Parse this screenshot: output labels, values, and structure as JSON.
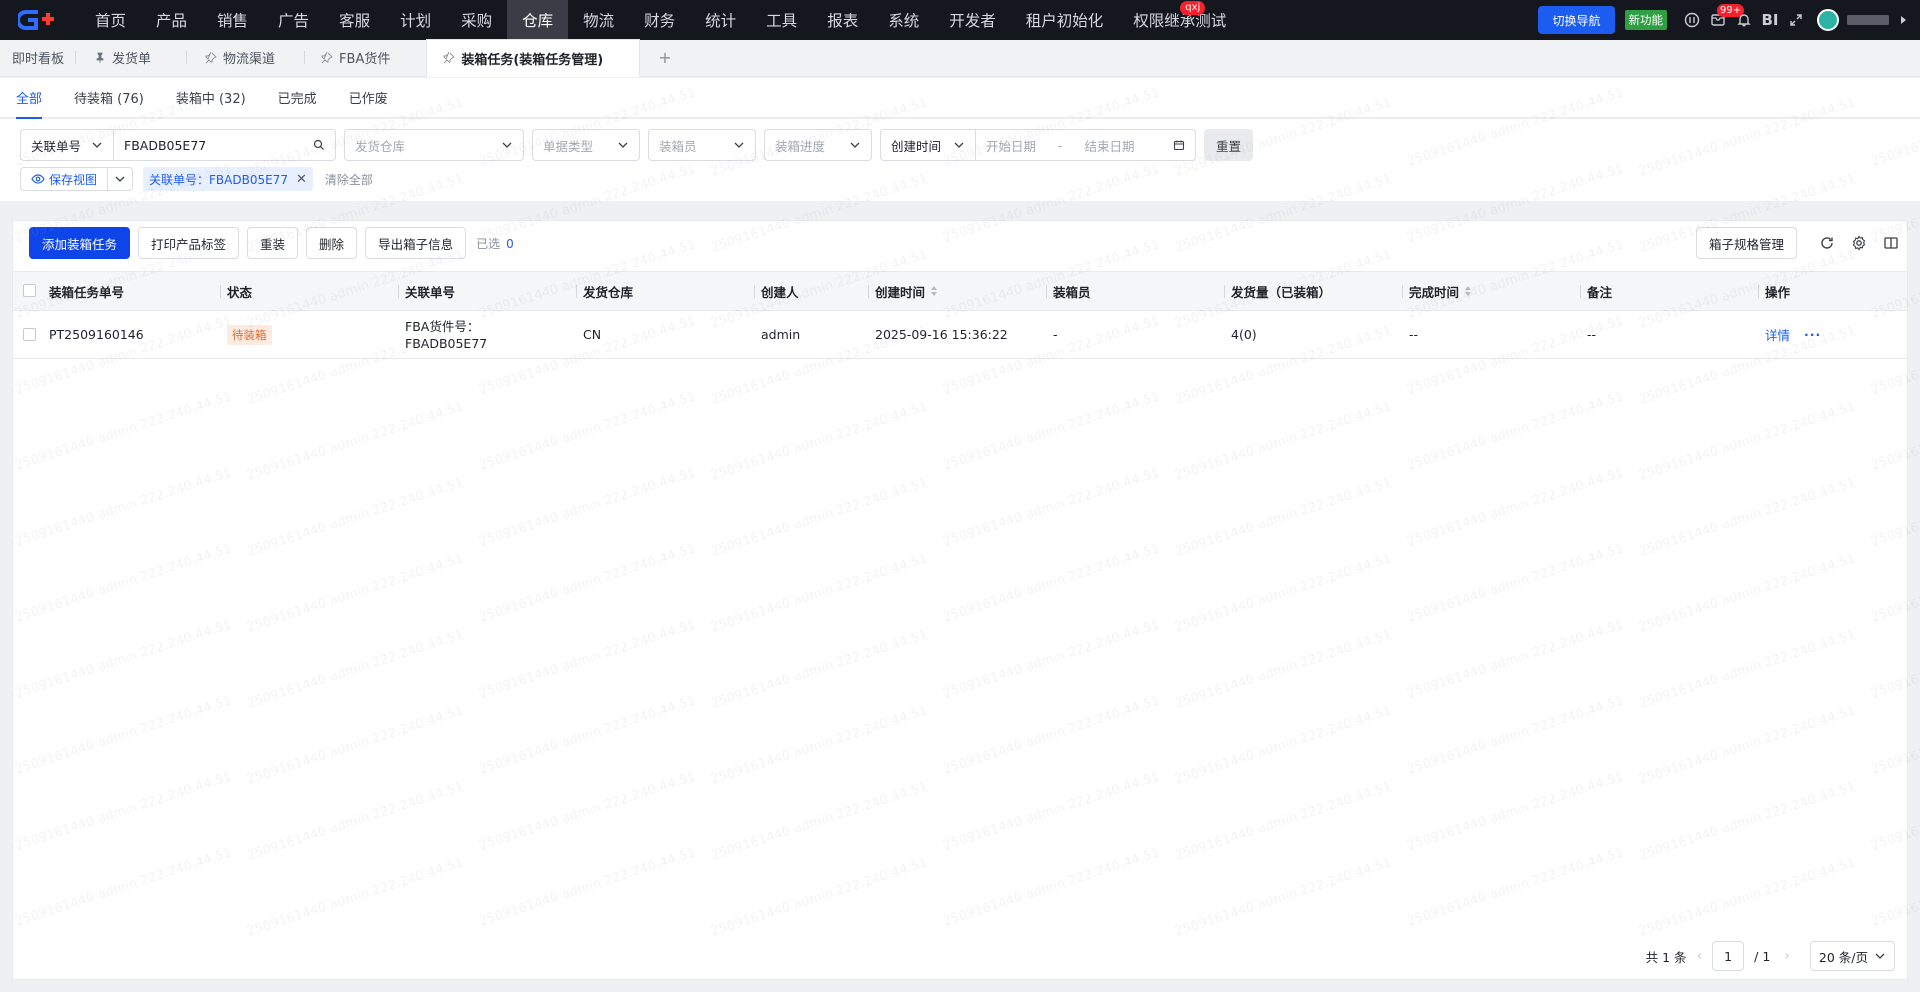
{
  "topnav": {
    "items": [
      {
        "label": "首页"
      },
      {
        "label": "产品"
      },
      {
        "label": "销售"
      },
      {
        "label": "广告"
      },
      {
        "label": "客服"
      },
      {
        "label": "计划"
      },
      {
        "label": "采购"
      },
      {
        "label": "仓库",
        "active": true
      },
      {
        "label": "物流"
      },
      {
        "label": "财务"
      },
      {
        "label": "统计"
      },
      {
        "label": "工具"
      },
      {
        "label": "报表"
      },
      {
        "label": "系统"
      },
      {
        "label": "开发者"
      },
      {
        "label": "租户初始化"
      },
      {
        "label": "权限继承测试",
        "badge": "qxj"
      }
    ],
    "switch_nav": "切换导航",
    "new_feature": "新功能",
    "message_badge": "99+",
    "bi_label": "BI"
  },
  "page_tabs": [
    {
      "label": "即时看板"
    },
    {
      "label": "发货单",
      "pinned": true
    },
    {
      "label": "物流渠道"
    },
    {
      "label": "FBA货件"
    },
    {
      "label": "装箱任务(装箱任务管理)",
      "active": true
    }
  ],
  "page_tab_add": "+",
  "status_tabs": [
    {
      "label": "全部",
      "active": true
    },
    {
      "label": "待装箱 (76)"
    },
    {
      "label": "装箱中 (32)"
    },
    {
      "label": "已完成"
    },
    {
      "label": "已作废"
    }
  ],
  "filters": {
    "search_field": "关联单号",
    "search_value": "FBADB05E77",
    "warehouse_placeholder": "发货仓库",
    "doc_type_placeholder": "单据类型",
    "packer_placeholder": "装箱员",
    "progress_placeholder": "装箱进度",
    "time_field": "创建时间",
    "start_date_placeholder": "开始日期",
    "date_separator": "-",
    "end_date_placeholder": "结束日期",
    "reset": "重置",
    "save_view": "保存视图",
    "active_tag": "关联单号：FBADB05E77",
    "clear_all": "清除全部"
  },
  "toolbar": {
    "add_task": "添加装箱任务",
    "print_labels": "打印产品标签",
    "repack": "重装",
    "delete": "删除",
    "export_box": "导出箱子信息",
    "selected_label": "已选",
    "selected_count": "0",
    "box_spec": "箱子规格管理"
  },
  "table": {
    "headers": {
      "task_no": "装箱任务单号",
      "status": "状态",
      "ref_no": "关联单号",
      "warehouse": "发货仓库",
      "creator": "创建人",
      "created_at": "创建时间",
      "packer": "装箱员",
      "qty": "发货量（已装箱）",
      "finished_at": "完成时间",
      "remark": "备注",
      "actions": "操作"
    },
    "rows": [
      {
        "task_no": "PT2509160146",
        "status": "待装箱",
        "ref_line1": "FBA货件号：",
        "ref_line2": "FBADB05E77",
        "warehouse": "CN",
        "creator": "admin",
        "created_at": "2025-09-16 15:36:22",
        "packer": "-",
        "qty": "4(0)",
        "finished_at": "--",
        "remark": "--",
        "detail": "详情",
        "more": "···"
      }
    ]
  },
  "pager": {
    "total": "共 1 条",
    "current": "1",
    "of": "/  1",
    "page_size": "20 条/页"
  },
  "watermark": "2509161440 admin 222.240.44.51",
  "colors": {
    "accent": "#1d5cf0",
    "nav_bg": "#15171e",
    "status_pending": "#e06a2c"
  }
}
